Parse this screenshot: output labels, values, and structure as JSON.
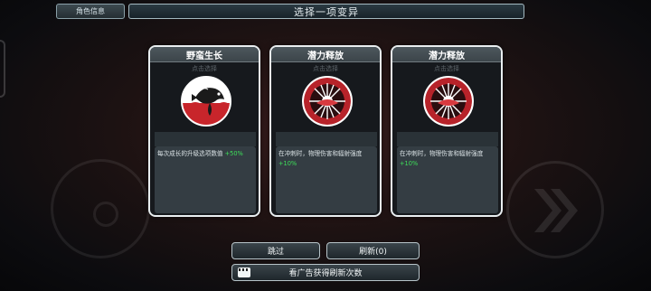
{
  "header": {
    "info_tab": "角色信息",
    "title": "选择一项变异"
  },
  "cards": [
    {
      "name": "野蛮生长",
      "subtitle": "点击选择",
      "icon": "fish-icon",
      "desc": "每次成长的升级选项数值 ",
      "bonus": "+50%"
    },
    {
      "name": "潜力释放",
      "subtitle": "点击选择",
      "icon": "burst-icon",
      "desc": "在冲刺时，物理伤害和辐射强度",
      "bonus": "+10%"
    },
    {
      "name": "潜力释放",
      "subtitle": "点击选择",
      "icon": "burst-icon",
      "desc": "在冲刺时，物理伤害和辐射强度",
      "bonus": "+10%"
    }
  ],
  "buttons": {
    "skip": "跳过",
    "refresh": "刷新(0)",
    "watch_ad": "看广告获得刷新次数"
  },
  "colors": {
    "bonus": "#3ee05a",
    "fish_red": "#c8252b",
    "burst_red": "#b7232a"
  }
}
